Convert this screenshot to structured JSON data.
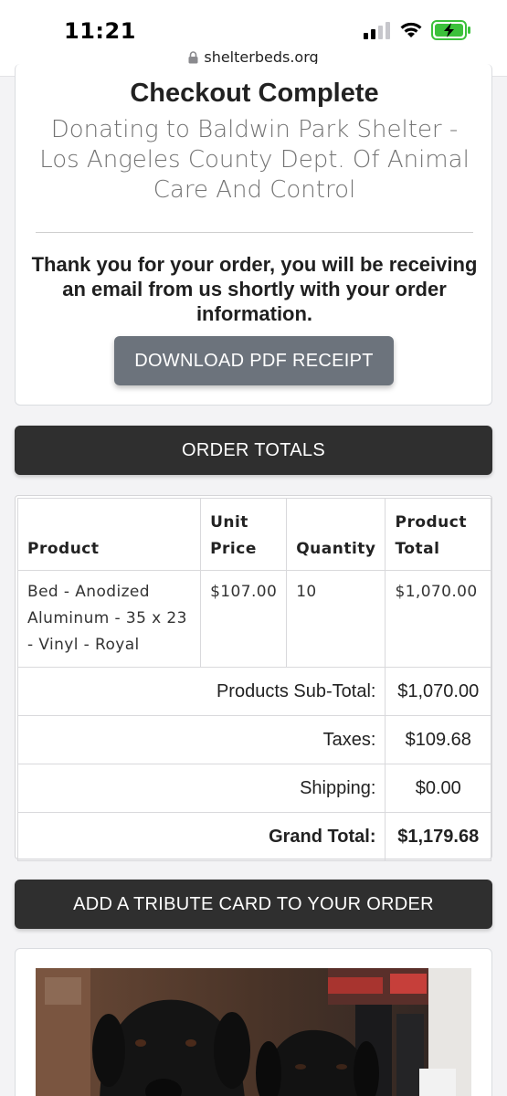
{
  "status": {
    "time": "11:21",
    "url": "shelterbeds.org",
    "icons": [
      "signal-icon",
      "wifi-icon",
      "battery-charging-icon",
      "lock-icon"
    ]
  },
  "checkout": {
    "title": "Checkout Complete",
    "shelter": "Donating to Baldwin Park Shelter - Los Angeles County Dept. Of Animal Care And Control",
    "thank_you": "Thank you for your order, you will be receiving an email from us shortly with your order information.",
    "download_label": "DOWNLOAD PDF RECEIPT"
  },
  "order_totals": {
    "header": "ORDER TOTALS",
    "columns": {
      "product": "Product",
      "unit_price": "Unit Price",
      "quantity": "Quantity",
      "product_total": "Product Total"
    },
    "rows": [
      {
        "product": "Bed - Anodized Aluminum - 35 x 23 - Vinyl - Royal",
        "unit_price": "$107.00",
        "quantity": "10",
        "total": "$1,070.00"
      }
    ],
    "subtotal_label": "Products Sub-Total:",
    "subtotal_value": "$1,070.00",
    "taxes_label": "Taxes:",
    "taxes_value": "$109.68",
    "shipping_label": "Shipping:",
    "shipping_value": "$0.00",
    "grand_total_label": "Grand Total:",
    "grand_total_value": "$1,179.68"
  },
  "tribute": {
    "button_label": "ADD A TRIBUTE CARD TO YOUR ORDER"
  },
  "colors": {
    "dark_bar": "#2f2f2f",
    "download_button": "#6c737c",
    "battery_green": "#3cc13b"
  }
}
